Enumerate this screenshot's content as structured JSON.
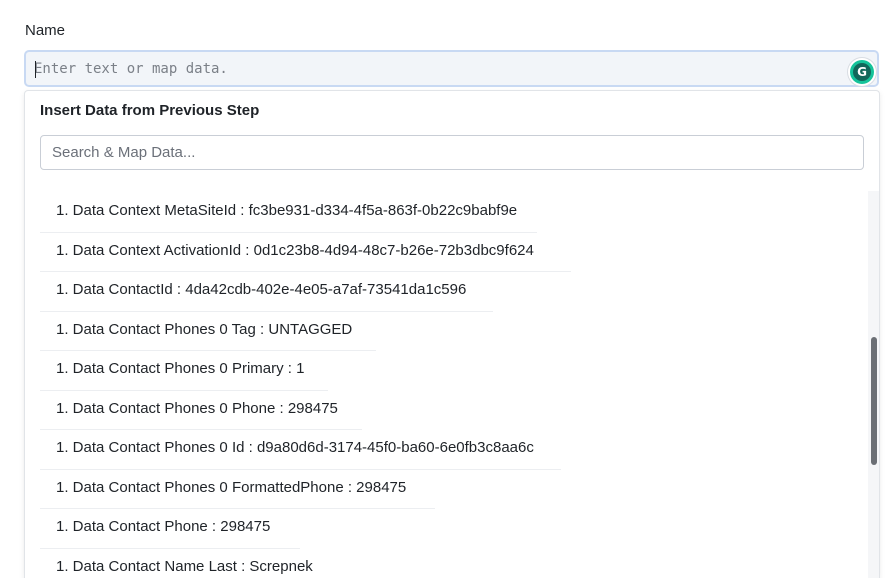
{
  "field": {
    "label": "Name",
    "placeholder": "Enter text or map data.",
    "value": ""
  },
  "grammarly": {
    "icon": "grammarly-icon",
    "glyph": "G",
    "color": "#15c39a"
  },
  "dropdown": {
    "title": "Insert Data from Previous Step",
    "search_placeholder": "Search & Map Data...",
    "items": [
      "1. Data Context MetaSiteId : fc3be931-d334-4f5a-863f-0b22c9babf9e",
      "1. Data Context ActivationId : 0d1c23b8-4d94-48c7-b26e-72b3dbc9f624",
      "1. Data ContactId : 4da42cdb-402e-4e05-a7af-73541da1c596",
      "1. Data Contact Phones 0 Tag : UNTAGGED",
      "1. Data Contact Phones 0 Primary : 1",
      "1. Data Contact Phones 0 Phone : 298475",
      "1. Data Contact Phones 0 Id : d9a80d6d-3174-45f0-ba60-6e0fb3c8aa6c",
      "1. Data Contact Phones 0 FormattedPhone : 298475",
      "1. Data Contact Phone : 298475",
      "1. Data Contact Name Last : Screpnek"
    ]
  }
}
